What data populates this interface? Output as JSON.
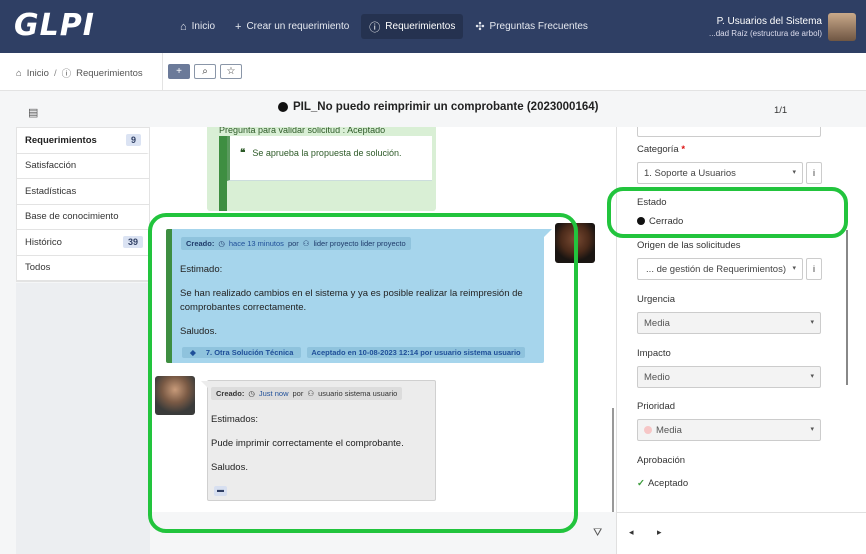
{
  "app": {
    "logo": "GLPI"
  },
  "nav": {
    "items": [
      {
        "icon": "⌂",
        "label": "Inicio"
      },
      {
        "icon": "+",
        "label": "Crear un requerimiento"
      },
      {
        "icon": "ⓘ",
        "label": "Requerimientos"
      },
      {
        "icon": "✣",
        "label": "Preguntas Frecuentes"
      }
    ]
  },
  "user": {
    "name": "P. Usuarios del Sistema",
    "entity": "...dad Raíz (estructura de arbol)"
  },
  "breadcrumb": {
    "home": "Inicio",
    "current": "Requerimientos"
  },
  "toolbar": {
    "add": "+",
    "search": "⌕",
    "star": "☆"
  },
  "ticket": {
    "title": "PIL_No puedo reimprimir un comprobante (2023000164)",
    "pager": "1/1"
  },
  "sidebar": {
    "items": [
      {
        "label": "Requerimientos",
        "badge": "9"
      },
      {
        "label": "Satisfacción",
        "badge": ""
      },
      {
        "label": "Estadísticas",
        "badge": ""
      },
      {
        "label": "Base de conocimiento",
        "badge": ""
      },
      {
        "label": "Histórico",
        "badge": "39"
      },
      {
        "label": "Todos",
        "badge": ""
      }
    ]
  },
  "timeline": {
    "top_followup": {
      "text": "Pregunta para validar solicitud : Aceptado",
      "quote": "Se aprueba la propuesta de solución."
    },
    "solution": {
      "created_label": "Creado:",
      "time": "hace 13 minutos",
      "by": "por",
      "author": "lider proyecto lider proyecto",
      "paragraphs": [
        "Estimado:",
        "Se han realizado cambios en el sistema y ya es posible realizar la reimpresión de comprobantes correctamente.",
        "Saludos."
      ],
      "solution_type": "7. Otra Solución Técnica",
      "accepted": "Aceptado en 10-08-2023 12:14 por usuario sistema usuario"
    },
    "user_followup": {
      "created_label": "Creado:",
      "time": "Just now",
      "by": "por",
      "author": "usuario sistema usuario",
      "paragraphs": [
        "Estimados:",
        "Pude imprimir correctamente el comprobante.",
        "Saludos."
      ]
    }
  },
  "fields": {
    "categoria": {
      "label": "Categoría",
      "required": "*",
      "value": "1. Soporte a Usuarios"
    },
    "estado": {
      "label": "Estado",
      "value": "Cerrado"
    },
    "origen": {
      "label": "Origen de las solicitudes",
      "value": "... de gestión de Requerimientos)"
    },
    "urgencia": {
      "label": "Urgencia",
      "value": "Media"
    },
    "impacto": {
      "label": "Impacto",
      "value": "Medio"
    },
    "prioridad": {
      "label": "Prioridad",
      "value": "Media"
    },
    "aprobacion": {
      "label": "Aprobación",
      "value": "Aceptado"
    }
  },
  "info_button": "i",
  "colors": {
    "header": "#2f3f64",
    "solution_bg": "#a6d5ec",
    "highlight": "#22c43d"
  }
}
